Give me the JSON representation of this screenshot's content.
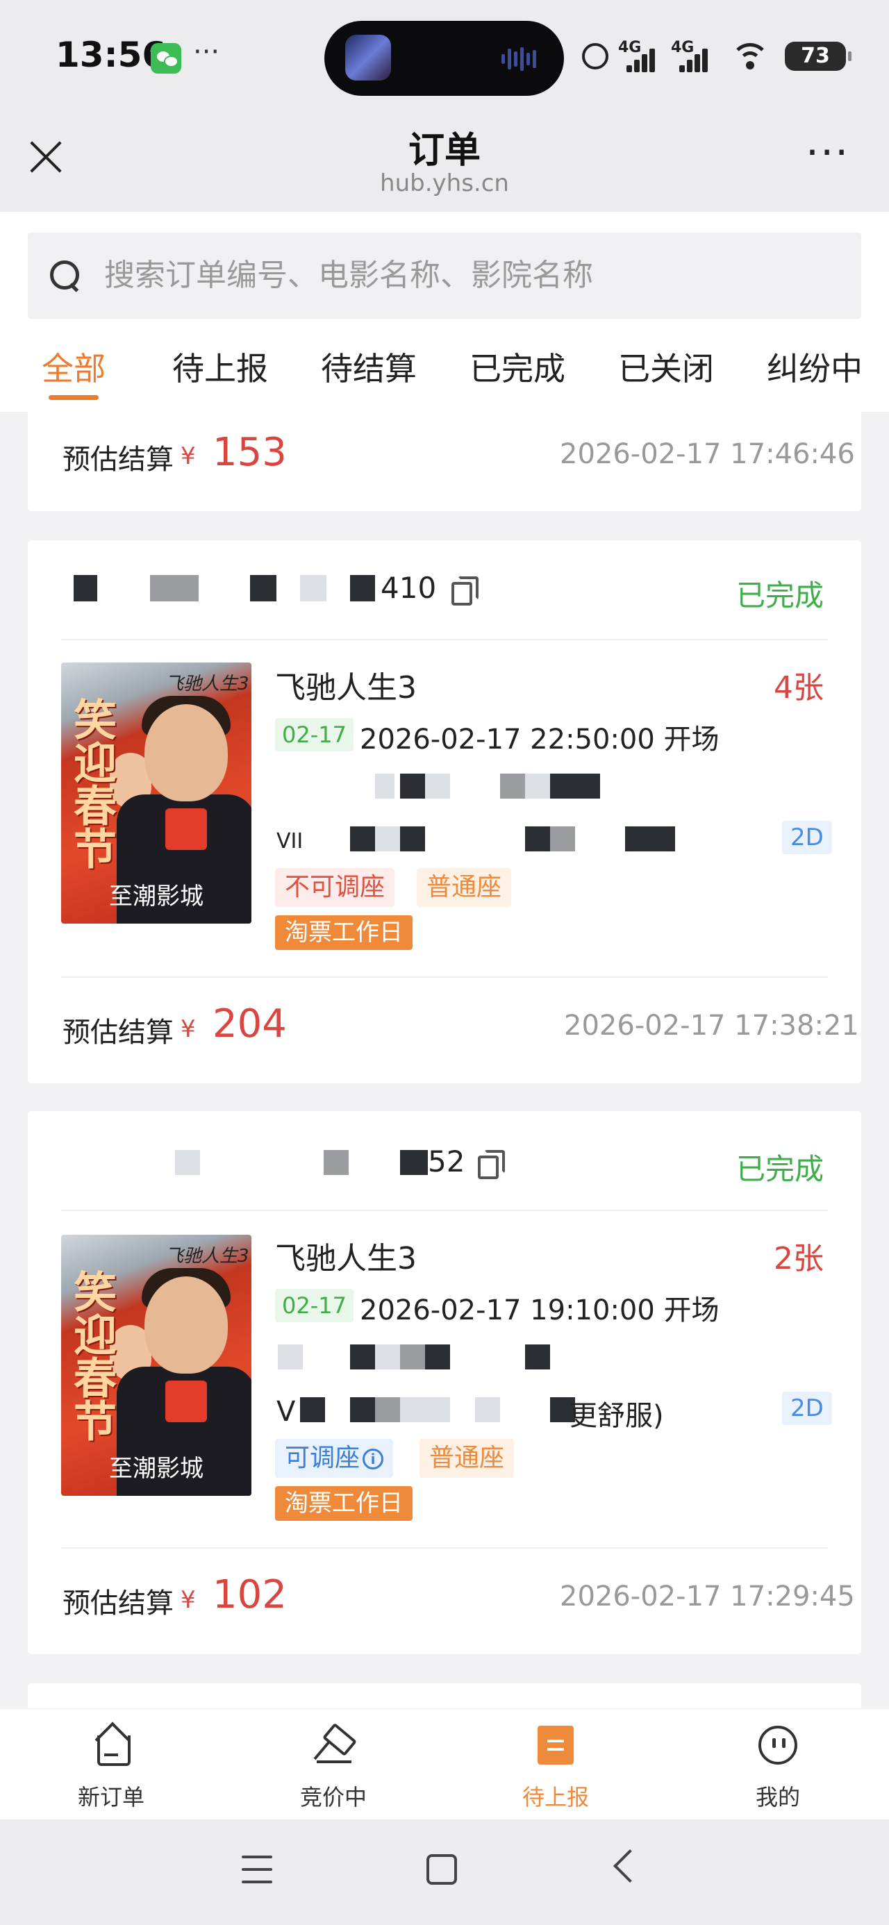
{
  "status_bar": {
    "time": "13:56",
    "dots": "···",
    "signal1": "4G",
    "signal2": "4G",
    "battery": "73"
  },
  "header": {
    "title": "订单",
    "url": "hub.yhs.cn",
    "more": "···"
  },
  "search": {
    "placeholder": "搜索订单编号、电影名称、影院名称"
  },
  "tabs": [
    "全部",
    "待上报",
    "待结算",
    "已完成",
    "已关闭",
    "纠纷中"
  ],
  "partial_card": {
    "price_label": "预估结算",
    "currency": "¥",
    "price": "153",
    "time": "2026-02-17 17:46:46"
  },
  "orders": [
    {
      "order_no_suffix": "410",
      "status": "已完成",
      "poster_title": "飞驰人生3",
      "poster_slogan": "笑迎春节",
      "cinema": "至潮影城",
      "movie": "飞驰人生3",
      "tickets": "4张",
      "date_tag": "02-17",
      "show_time": "2026-02-17 22:50:00 开场",
      "hall_visible": "VII",
      "format": "2D",
      "tags": [
        "不可调座",
        "普通座"
      ],
      "promo": "淘票工作日",
      "price_label": "预估结算",
      "currency": "¥",
      "price": "204",
      "time": "2026-02-17 17:38:21"
    },
    {
      "order_no_suffix": "52",
      "status": "已完成",
      "poster_title": "飞驰人生3",
      "poster_slogan": "笑迎春节",
      "cinema": "至潮影城",
      "movie": "飞驰人生3",
      "tickets": "2张",
      "date_tag": "02-17",
      "show_time": "2026-02-17 19:10:00 开场",
      "hall_visible": "V",
      "hall_suffix": "更舒服)",
      "format": "2D",
      "tags": [
        "可调座",
        "普通座"
      ],
      "info_icon": "i",
      "promo": "淘票工作日",
      "price_label": "预估结算",
      "currency": "¥",
      "price": "102",
      "time": "2026-02-17 17:29:45"
    }
  ],
  "bottom_nav": [
    "新订单",
    "竞价中",
    "待上报",
    "我的"
  ],
  "icons": {
    "close": "close-icon",
    "search": "search-icon",
    "copy": "copy-icon",
    "home": "home-icon",
    "gavel": "gavel-icon",
    "list": "list-icon",
    "profile": "face-icon"
  },
  "colors": {
    "accent": "#ef7b2c",
    "price": "#d9463f",
    "success": "#3fae4a",
    "info": "#4a8de0"
  }
}
